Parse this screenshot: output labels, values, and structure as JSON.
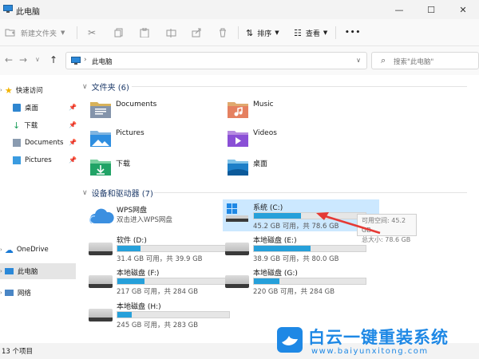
{
  "window": {
    "title": "此电脑"
  },
  "toolbar": {
    "new_folder": "新建文件夹",
    "sort": "排序",
    "view": "查看",
    "more": "•••"
  },
  "address": {
    "path": "此电脑"
  },
  "search": {
    "placeholder": "搜索\"此电脑\""
  },
  "sidebar": {
    "quick_access": "快速访问",
    "items": [
      "桌面",
      "下载",
      "Documents",
      "Pictures"
    ],
    "onedrive": "OneDrive",
    "this_pc": "此电脑",
    "network": "网络"
  },
  "folders": {
    "header": "文件夹 (6)",
    "items": [
      {
        "name": "Documents",
        "icon": "documents-folder-icon"
      },
      {
        "name": "Music",
        "icon": "music-folder-icon"
      },
      {
        "name": "Pictures",
        "icon": "pictures-folder-icon"
      },
      {
        "name": "Videos",
        "icon": "videos-folder-icon"
      },
      {
        "name": "下载",
        "icon": "downloads-folder-icon"
      },
      {
        "name": "桌面",
        "icon": "desktop-folder-icon"
      }
    ]
  },
  "devices": {
    "header": "设备和驱动器 (7)",
    "wps": {
      "name": "WPS网盘",
      "desc": "双击进入WPS网盘"
    },
    "drives": [
      {
        "name": "系统 (C:)",
        "capacity": "45.2 GB 可用，共 78.6 GB",
        "used": 0.42
      },
      {
        "name": "软件 (D:)",
        "capacity": "31.4 GB 可用，共 39.9 GB",
        "used": 0.21
      },
      {
        "name": "本地磁盘 (E:)",
        "capacity": "38.9 GB 可用，共 80.0 GB",
        "used": 0.51
      },
      {
        "name": "本地磁盘 (F:)",
        "capacity": "217 GB 可用，共 284 GB",
        "used": 0.24
      },
      {
        "name": "本地磁盘 (G:)",
        "capacity": "220 GB 可用，共 284 GB",
        "used": 0.23
      },
      {
        "name": "本地磁盘 (H:)",
        "capacity": "245 GB 可用，共 283 GB",
        "used": 0.13
      }
    ]
  },
  "tooltip": {
    "line1": "可用空间: 45.2 GB",
    "line2": "总大小: 78.6 GB"
  },
  "status": {
    "count": "13 个项目"
  },
  "watermark": {
    "title": "白云一键重装系统",
    "url": "www.baiyunxitong.com"
  },
  "colors": {
    "accent": "#26a0da",
    "heading": "#1e3b6a",
    "selected": "#cce8ff",
    "arrow": "#e53935",
    "brand": "#1e88e5"
  }
}
